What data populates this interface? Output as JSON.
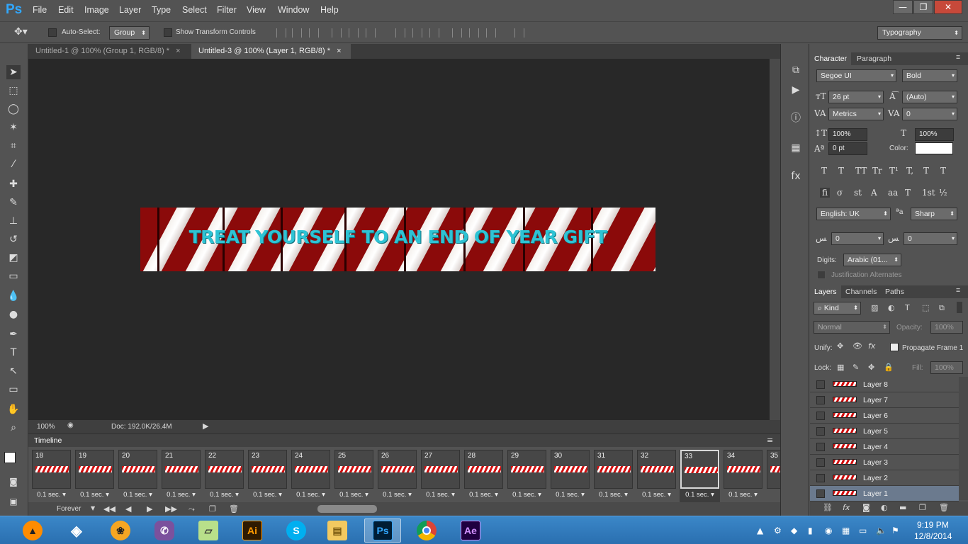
{
  "app": {
    "logo": "Ps"
  },
  "menu": [
    "File",
    "Edit",
    "Image",
    "Layer",
    "Type",
    "Select",
    "Filter",
    "View",
    "Window",
    "Help"
  ],
  "window_controls": {
    "minimize": "—",
    "restore": "❐",
    "close": "✕"
  },
  "options": {
    "auto_select_label": "Auto-Select:",
    "auto_select_value": "Group",
    "show_transform_label": "Show Transform Controls",
    "workspace": "Typography"
  },
  "tabs": [
    {
      "label": "Untitled-1 @ 100% (Group 1, RGB/8) *",
      "close": "×"
    },
    {
      "label": "Untitled-3 @ 100% (Layer 1, RGB/8) *",
      "close": "×"
    }
  ],
  "canvas": {
    "banner_text": "TREAT YOURSELF TO AN END OF YEAR GIFT"
  },
  "status": {
    "zoom": "100%",
    "doc": "Doc: 192.0K/26.4M"
  },
  "timeline": {
    "title": "Timeline",
    "loop": "Forever",
    "frames": [
      {
        "num": "18",
        "delay": "0.1 sec."
      },
      {
        "num": "19",
        "delay": "0.1 sec."
      },
      {
        "num": "20",
        "delay": "0.1 sec."
      },
      {
        "num": "21",
        "delay": "0.1 sec."
      },
      {
        "num": "22",
        "delay": "0.1 sec."
      },
      {
        "num": "23",
        "delay": "0.1 sec."
      },
      {
        "num": "24",
        "delay": "0.1 sec."
      },
      {
        "num": "25",
        "delay": "0.1 sec."
      },
      {
        "num": "26",
        "delay": "0.1 sec."
      },
      {
        "num": "27",
        "delay": "0.1 sec."
      },
      {
        "num": "28",
        "delay": "0.1 sec."
      },
      {
        "num": "29",
        "delay": "0.1 sec."
      },
      {
        "num": "30",
        "delay": "0.1 sec."
      },
      {
        "num": "31",
        "delay": "0.1 sec."
      },
      {
        "num": "32",
        "delay": "0.1 sec."
      },
      {
        "num": "33",
        "delay": "0.1 sec."
      },
      {
        "num": "34",
        "delay": "0.1 sec."
      },
      {
        "num": "35",
        "delay": "0."
      }
    ],
    "selected_frame": "33"
  },
  "character": {
    "tab1": "Character",
    "tab2": "Paragraph",
    "font": "Segoe UI",
    "style": "Bold",
    "size": "26 pt",
    "leading": "(Auto)",
    "kerning": "Metrics",
    "tracking": "0",
    "vscale": "100%",
    "hscale": "100%",
    "baseline": "0 pt",
    "color_label": "Color:",
    "language": "English: UK",
    "aa_label": "a",
    "aa": "Sharp",
    "kashida1": "0",
    "kashida2": "0",
    "digits_label": "Digits:",
    "digits": "Arabic (01...",
    "justification": "Justification Alternates",
    "style_icons": [
      "T",
      "T",
      "TT",
      "Tr",
      "T¹",
      "T,",
      "T",
      "T"
    ],
    "ot_icons": [
      "fi",
      "σ",
      "st",
      "A",
      "aa",
      "T",
      "1st",
      "½"
    ]
  },
  "layers_panel": {
    "tab1": "Layers",
    "tab2": "Channels",
    "tab3": "Paths",
    "kind": "Kind",
    "blend": "Normal",
    "opacity_label": "Opacity:",
    "opacity": "100%",
    "unify_label": "Unify:",
    "propagate": "Propagate Frame 1",
    "lock_label": "Lock:",
    "fill_label": "Fill:",
    "fill": "100%",
    "layers": [
      "Layer 8",
      "Layer 7",
      "Layer 6",
      "Layer 5",
      "Layer 4",
      "Layer 3",
      "Layer 2",
      "Layer 1"
    ],
    "selected_layer": "Layer 1"
  },
  "taskbar": {
    "apps": [
      "avast",
      "unity",
      "fl-studio",
      "viber",
      "notes",
      "Ai",
      "skype",
      "explorer",
      "Ps",
      "chrome",
      "Ae"
    ],
    "time": "9:19 PM",
    "date": "12/8/2014"
  }
}
